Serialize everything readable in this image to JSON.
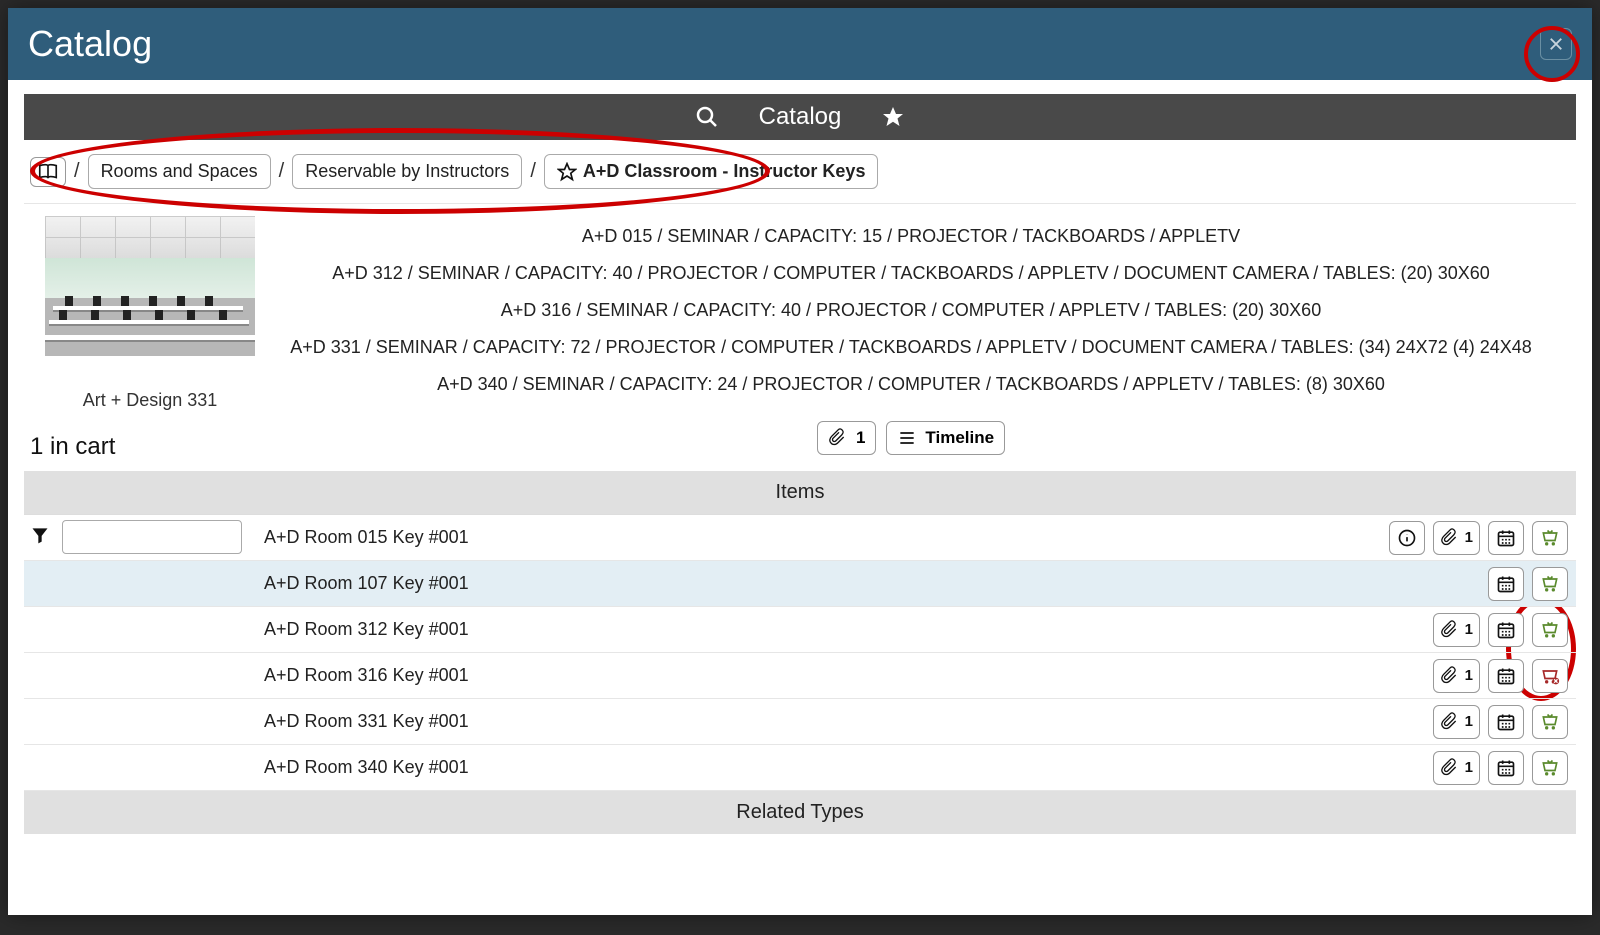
{
  "modal": {
    "title": "Catalog"
  },
  "toolbar": {
    "title": "Catalog"
  },
  "breadcrumb": {
    "sep": "/",
    "items": [
      {
        "label": "Rooms and Spaces"
      },
      {
        "label": "Reservable by Instructors"
      },
      {
        "label": "A+D Classroom - Instructor Keys",
        "starred": true
      }
    ]
  },
  "thumbnail": {
    "caption": "Art + Design 331"
  },
  "cart": {
    "line": "1 in cart"
  },
  "descriptions": [
    "A+D 015 / SEMINAR / CAPACITY: 15 / PROJECTOR / TACKBOARDS / APPLETV",
    "A+D 312 / SEMINAR / CAPACITY: 40 / PROJECTOR / COMPUTER / TACKBOARDS / APPLETV / DOCUMENT CAMERA / TABLES: (20) 30X60",
    "A+D 316 / SEMINAR / CAPACITY: 40 / PROJECTOR / COMPUTER / APPLETV / TABLES: (20) 30X60",
    "A+D 331 / SEMINAR / CAPACITY: 72 / PROJECTOR / COMPUTER / TACKBOARDS / APPLETV / DOCUMENT CAMERA / TABLES: (34) 24X72 (4) 24X48",
    "A+D 340 / SEMINAR / CAPACITY: 24 / PROJECTOR / COMPUTER / TACKBOARDS / APPLETV / TABLES: (8) 30X60"
  ],
  "pills": {
    "attach_count": "1",
    "timeline": "Timeline"
  },
  "sections": {
    "items": "Items",
    "related": "Related Types"
  },
  "filter": {
    "value": ""
  },
  "items": [
    {
      "name": "A+D Room 015 Key #001",
      "selected": false,
      "info": true,
      "attach": "1",
      "cal": true,
      "cart": "add"
    },
    {
      "name": "A+D Room 107 Key #001",
      "selected": true,
      "info": false,
      "attach": null,
      "cal": true,
      "cart": "add"
    },
    {
      "name": "A+D Room 312 Key #001",
      "selected": false,
      "info": false,
      "attach": "1",
      "cal": true,
      "cart": "add"
    },
    {
      "name": "A+D Room 316 Key #001",
      "selected": false,
      "info": false,
      "attach": "1",
      "cal": true,
      "cart": "remove"
    },
    {
      "name": "A+D Room 331 Key #001",
      "selected": false,
      "info": false,
      "attach": "1",
      "cal": true,
      "cart": "add"
    },
    {
      "name": "A+D Room 340 Key #001",
      "selected": false,
      "info": false,
      "attach": "1",
      "cal": true,
      "cart": "add"
    }
  ]
}
